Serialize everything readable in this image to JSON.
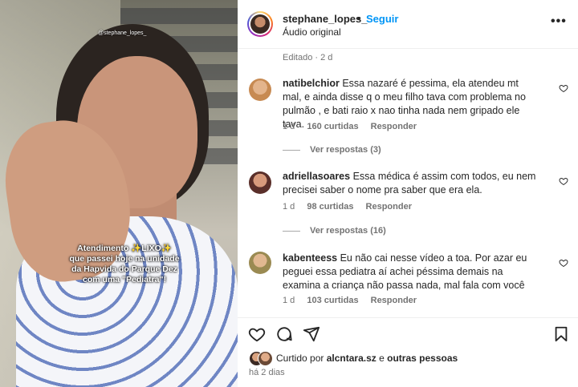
{
  "post": {
    "username": "stephane_lopes_",
    "separator": "•",
    "follow_label": "Seguir",
    "audio": "Áudio original",
    "more_label": "•••",
    "edited": "Editado · 2 d",
    "video_watermark": "@stephane_lopes_",
    "overlay_lines": [
      "Atendimento ✨LIXO✨",
      "que passei hoje na unidade",
      "da Hapvida do Parque Dez",
      "com uma \"Pediatra\"!"
    ]
  },
  "comments": [
    {
      "user": "natibelchior",
      "text": "Essa nazaré é pessima, ela atendeu mt mal, e ainda disse q o meu filho tava com problema no pulmão , e bati raio x nao tinha nada nem gripado ele tava.",
      "age": "1 d",
      "likes": "160 curtidas",
      "reply_label": "Responder",
      "view_replies": "Ver respostas (3)"
    },
    {
      "user": "adriellasoares",
      "text": "Essa médica é assim com todos, eu nem precisei saber o nome pra saber que era ela.",
      "age": "1 d",
      "likes": "98 curtidas",
      "reply_label": "Responder",
      "view_replies": "Ver respostas (16)"
    },
    {
      "user": "kabenteess",
      "text": "Eu não cai nesse vídeo a toa. Por azar eu peguei essa pediatra aí achei péssima demais na examina a criança não passa nada, mal fala com você",
      "age": "1 d",
      "likes": "103 curtidas",
      "reply_label": "Responder"
    }
  ],
  "likes": {
    "prefix": "Curtido por",
    "user": "alcntara.sz",
    "joiner": "e",
    "others": "outras pessoas"
  },
  "time": "há 2 dias",
  "colors": {
    "link_blue": "#0095f6",
    "muted": "#737373",
    "text": "#262626"
  }
}
